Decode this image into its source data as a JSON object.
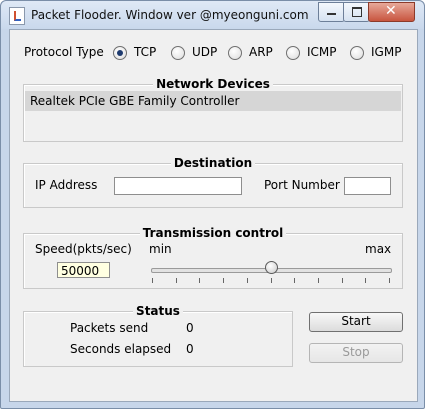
{
  "window": {
    "title": "Packet Flooder. Window ver @myeonguni.com"
  },
  "protocol": {
    "label": "Protocol Type",
    "options": [
      {
        "label": "TCP",
        "selected": true
      },
      {
        "label": "UDP",
        "selected": false
      },
      {
        "label": "ARP",
        "selected": false
      },
      {
        "label": "ICMP",
        "selected": false
      },
      {
        "label": "IGMP",
        "selected": false
      }
    ]
  },
  "network_devices": {
    "title": "Network Devices",
    "items": [
      "Realtek PCIe GBE Family Controller"
    ]
  },
  "destination": {
    "title": "Destination",
    "ip_label": "IP Address",
    "ip_value": "",
    "port_label": "Port Number",
    "port_value": ""
  },
  "transmission": {
    "title": "Transmission control",
    "speed_label": "Speed(pkts/sec)",
    "speed_value": "50000",
    "slider_min_label": "min",
    "slider_max_label": "max",
    "slider_level": 0.5
  },
  "status": {
    "title": "Status",
    "packets_label": "Packets send",
    "packets_value": "0",
    "seconds_label": "Seconds elapsed",
    "seconds_value": "0"
  },
  "buttons": {
    "start": "Start",
    "stop": "Stop"
  }
}
